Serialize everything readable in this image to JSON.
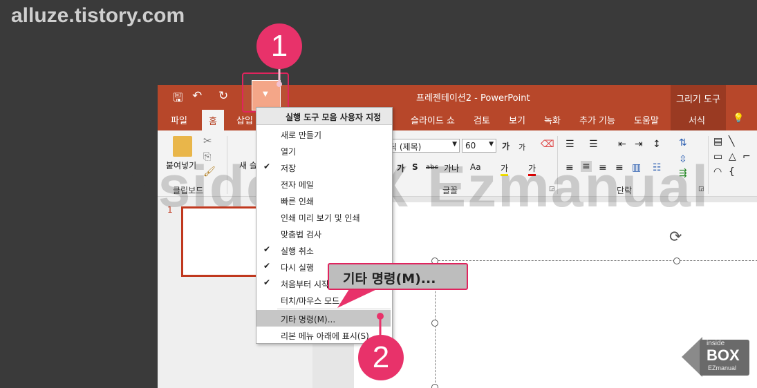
{
  "watermark_top": "alluze.tistory.com",
  "watermark_center": "insideBOX Ezmanual",
  "title_bar": {
    "document_title": "프레젠테이션2 - PowerPoint",
    "contextual_tab_group": "그리기 도구"
  },
  "tabs": [
    "파일",
    "홈",
    "삽입",
    "슬라이드 쇼",
    "검토",
    "보기",
    "녹화",
    "추가 기능",
    "도움말",
    "서식"
  ],
  "ribbon": {
    "clipboard_label": "클립보드",
    "paste_label": "붙여넣기",
    "new_slide_label": "새 슬",
    "font_name": "딕 (제목)",
    "font_size": "60",
    "font_group_label": "글꼴",
    "paragraph_group_label": "단락",
    "font_grow": "가",
    "font_shrink": "가",
    "char_spacing": "가나",
    "change_case": "Aa",
    "highlight": "가",
    "font_color": "가"
  },
  "thumbnail_number": "1",
  "qat_menu": {
    "title": "실행 도구 모음 사용자 지정",
    "items": [
      {
        "label": "새로 만들기",
        "checked": false
      },
      {
        "label": "열기",
        "checked": false
      },
      {
        "label": "저장",
        "checked": true
      },
      {
        "label": "전자 메일",
        "checked": false
      },
      {
        "label": "빠른 인쇄",
        "checked": false
      },
      {
        "label": "인쇄 미리 보기 및 인쇄",
        "checked": false
      },
      {
        "label": "맞춤법 검사",
        "checked": false
      },
      {
        "label": "실행 취소",
        "checked": true
      },
      {
        "label": "다시 실행",
        "checked": true
      },
      {
        "label": "처음부터 시작",
        "checked": true
      },
      {
        "label": "터치/마우스 모드",
        "checked": false
      },
      {
        "label": "기타 명령(M)...",
        "checked": false
      },
      {
        "label": "리본 메뉴 아래에 표시(S)",
        "checked": false
      }
    ],
    "check_glyph": "✔"
  },
  "callout_text": "기타 명령(M)...",
  "badges": [
    "1",
    "2"
  ],
  "logo": {
    "line1": "inside",
    "line2": "BOX",
    "line3": "EZmanual"
  },
  "colors": {
    "ppt_accent": "#b7472a",
    "badge": "#e8326a"
  }
}
